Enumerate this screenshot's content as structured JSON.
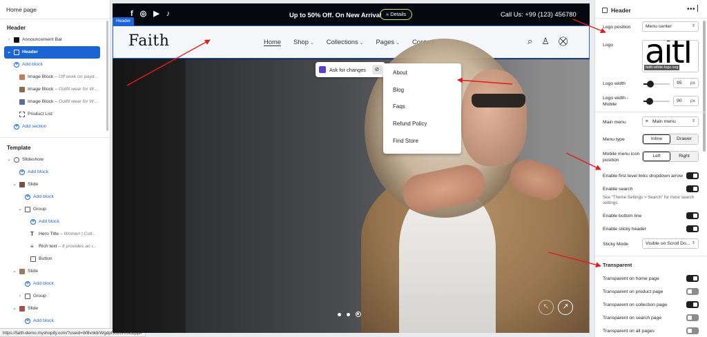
{
  "left": {
    "title": "Home page",
    "header_section": "Header",
    "items": [
      {
        "chev": "›",
        "label": "Announcement Bar",
        "sub": ""
      },
      {
        "chev": "⌄",
        "label": "Header",
        "sub": ""
      }
    ],
    "add_block_1": "Add block",
    "image_blocks": [
      {
        "label": "Image Block",
        "sub": " – Off work on payd..."
      },
      {
        "label": "Image Block",
        "sub": " – Outfit wear for W..."
      },
      {
        "label": "Image Block",
        "sub": " – Outfit wear for W..."
      }
    ],
    "product_list": "Product List",
    "add_section": "Add section",
    "template_section": "Template",
    "slideshow": "Slideshow",
    "add_block": "Add block",
    "slide": "Slide",
    "group": "Group",
    "hero_title": "Hero Title",
    "hero_title_sub": " – Women | Coll...",
    "rich_text": "Rich text",
    "rich_text_sub": " – It provides an i...",
    "button": "Button"
  },
  "status_url": "https://faith-demo.myshopify.com/?oseid=W8vnktirWgdpf5526RrbCZpp#",
  "preview": {
    "header_tag": "Header",
    "social": [
      "f",
      "◎",
      "▶",
      "♪"
    ],
    "promo": "Up to 50% Off. On New Arrival",
    "details_label": "» Details",
    "call": "Call Us: +99 (123) 456780",
    "logo": "Faith",
    "nav": [
      {
        "label": "Home",
        "caret": ""
      },
      {
        "label": "Shop",
        "caret": "⌄"
      },
      {
        "label": "Collections",
        "caret": "⌄"
      },
      {
        "label": "Pages",
        "caret": "⌄"
      },
      {
        "label": "Contact",
        "caret": ""
      }
    ],
    "icons": {
      "search": "⌕",
      "account": "♙",
      "cart": "⛒"
    },
    "ask_label": "Ask for changes",
    "menu": [
      "About",
      "Blog",
      "Faqs",
      "Refund Policy",
      "Find Store"
    ],
    "prev_arrow": "↖",
    "next_arrow": "↗",
    "slide_count": 3,
    "current_slide": 3
  },
  "right": {
    "title": "Header",
    "more": "•••",
    "logo_position_label": "Logo position",
    "logo_position_value": "Menu center",
    "logo_label": "Logo",
    "logo_thumb_text": "aitl",
    "logo_thumb_caption": "faith-white-logo.svg",
    "logo_width_label": "Logo width",
    "logo_width_value": "95",
    "logo_width_fraction": 0.25,
    "logo_width_mobile_label": "Logo width - Mobile",
    "logo_width_mobile_value": "90",
    "logo_width_mobile_fraction": 0.23,
    "unit": "px",
    "main_menu_label": "Main menu",
    "main_menu_value": "Main menu",
    "menu_type_label": "Menu type",
    "menu_type_options": [
      "Inline",
      "Drawer"
    ],
    "menu_type_selected": "Inline",
    "mobile_icon_label": "Mobile menu icon position",
    "mobile_icon_options": [
      "Left",
      "Right"
    ],
    "mobile_icon_selected": "Left",
    "toggles": [
      {
        "label": "Enable first level links dropdown arrow",
        "on": true
      },
      {
        "label": "Enable search",
        "on": true
      },
      {
        "label": "Enable bottom line",
        "on": true
      },
      {
        "label": "Enable sticky header",
        "on": true
      }
    ],
    "search_hint": "See \"Theme Settings > Search\" for more search settings.",
    "sticky_mode_label": "Sticky Mode",
    "sticky_mode_value": "Visible on Scroll Do...",
    "transparent_heading": "Transparent",
    "transparent_toggles": [
      {
        "label": "Transparent on home page",
        "on": true
      },
      {
        "label": "Transparent on product page",
        "on": false
      },
      {
        "label": "Transparent on collection page",
        "on": true
      },
      {
        "label": "Transparent on search page",
        "on": false
      },
      {
        "label": "Transparent on all pages",
        "on": false
      }
    ]
  },
  "colors": {
    "accent": "#1a64d6",
    "announcement_bg": "#06080f",
    "arrow": "#e31b1b",
    "details_border": "#b6f07a"
  }
}
